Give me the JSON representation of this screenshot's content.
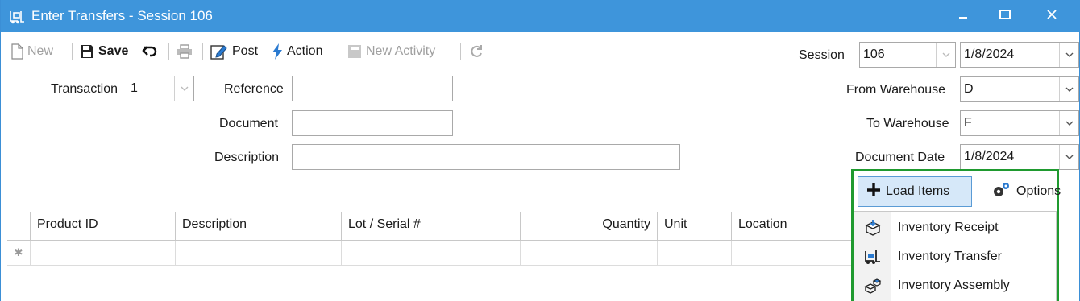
{
  "window": {
    "title": "Enter Transfers - Session 106",
    "app_icon": "forklift-icon",
    "controls": [
      "minimize-icon",
      "maximize-icon",
      "close-icon"
    ]
  },
  "toolbar": {
    "new_label": "New",
    "save_label": "Save",
    "post_label": "Post",
    "action_label": "Action",
    "new_activity_label": "New Activity"
  },
  "form": {
    "transaction_label": "Transaction",
    "transaction_value": "1",
    "reference_label": "Reference",
    "reference_value": "",
    "document_label": "Document",
    "document_value": "",
    "description_label": "Description",
    "description_value": "",
    "session_label": "Session",
    "session_value": "106",
    "session_date": "1/8/2024",
    "from_warehouse_label": "From Warehouse",
    "from_warehouse_value": "D",
    "to_warehouse_label": "To Warehouse",
    "to_warehouse_value": "F",
    "document_date_label": "Document Date",
    "document_date_value": "1/8/2024"
  },
  "grid": {
    "columns": [
      "Product ID",
      "Description",
      "Lot / Serial #",
      "Quantity",
      "Unit",
      "Location"
    ],
    "new_row_marker": "✱"
  },
  "load_items": {
    "button_label": "Load Items",
    "options_label": "Options",
    "menu": [
      {
        "label": "Inventory Receipt",
        "icon": "receipt-box-icon"
      },
      {
        "label": "Inventory Transfer",
        "icon": "forklift-icon"
      },
      {
        "label": "Inventory Assembly",
        "icon": "assembly-icon"
      }
    ]
  },
  "colors": {
    "titlebar": "#3e95db",
    "highlight_border": "#1f9a2f",
    "load_button_bg": "#d6e8f9"
  }
}
